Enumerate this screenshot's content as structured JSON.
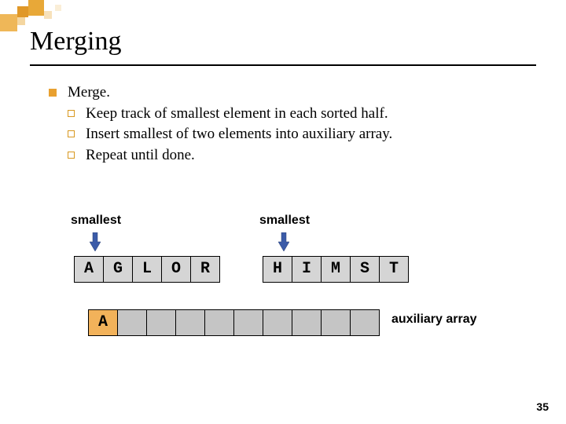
{
  "title": "Merging",
  "bullets": {
    "main": "Merge.",
    "sub1": "Keep track of smallest element in each sorted half.",
    "sub2": "Insert smallest of two elements into auxiliary array.",
    "sub3": "Repeat until done."
  },
  "labels": {
    "smallest1": "smallest",
    "smallest2": "smallest",
    "auxiliary": "auxiliary array"
  },
  "left_array": [
    "A",
    "G",
    "L",
    "O",
    "R"
  ],
  "right_array": [
    "H",
    "I",
    "M",
    "S",
    "T"
  ],
  "aux_array": [
    "A",
    "",
    "",
    "",
    "",
    "",
    "",
    "",
    "",
    ""
  ],
  "pagenum": "35",
  "colors": {
    "accent": "#e8a030",
    "arrow": "#3b5ba8"
  }
}
